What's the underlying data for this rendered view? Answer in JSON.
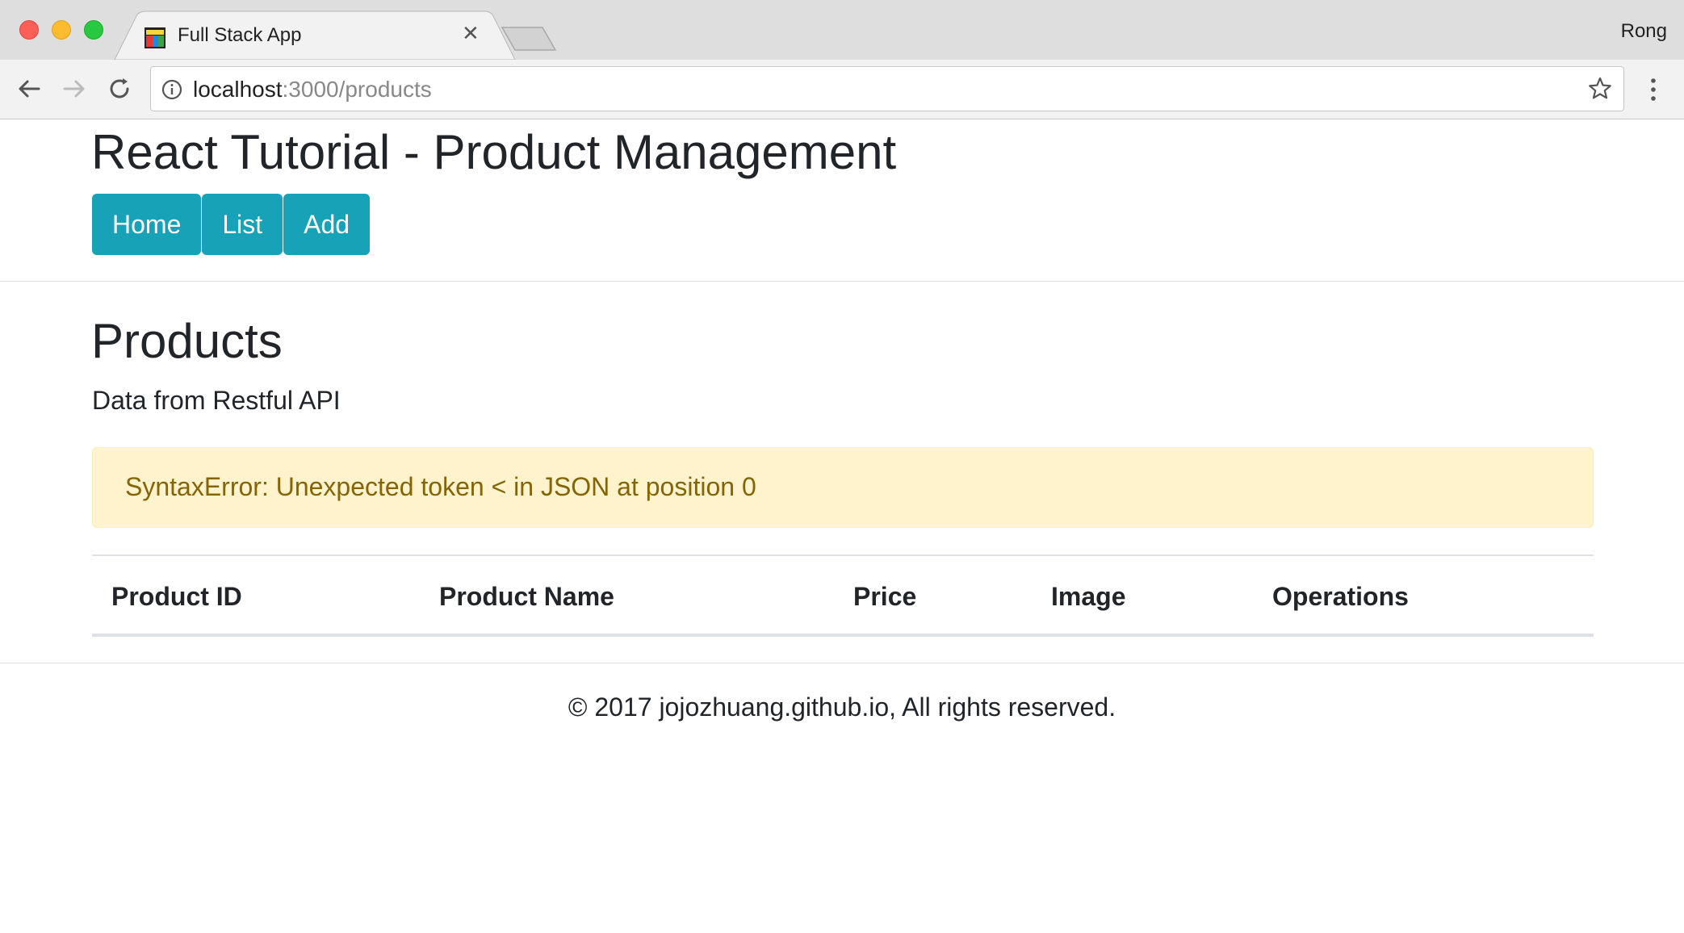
{
  "browser": {
    "tab_title": "Full Stack App",
    "profile_name": "Rong",
    "url_host": "localhost",
    "url_rest": ":3000/products",
    "colors": {
      "close": "#fc5f57",
      "minimize": "#fdbc2e",
      "maximize": "#28c840"
    }
  },
  "header": {
    "title": "React Tutorial - Product Management",
    "nav": [
      {
        "label": "Home"
      },
      {
        "label": "List"
      },
      {
        "label": "Add"
      }
    ],
    "nav_color": "#17a2b8"
  },
  "main": {
    "title": "Products",
    "lead": "Data from Restful API",
    "alert": {
      "text": "SyntaxError: Unexpected token < in JSON at position 0",
      "background": "#fff3cd",
      "text_color": "#856404"
    },
    "table": {
      "columns": [
        "Product ID",
        "Product Name",
        "Price",
        "Image",
        "Operations"
      ],
      "rows": []
    }
  },
  "footer": {
    "text": "© 2017 jojozhuang.github.io, All rights reserved."
  },
  "icons": [
    "close-window-icon",
    "minimize-window-icon",
    "maximize-window-icon",
    "favicon-icon",
    "tab-close-icon",
    "back-arrow-icon",
    "forward-arrow-icon",
    "reload-icon",
    "info-icon",
    "star-icon",
    "more-menu-icon"
  ]
}
